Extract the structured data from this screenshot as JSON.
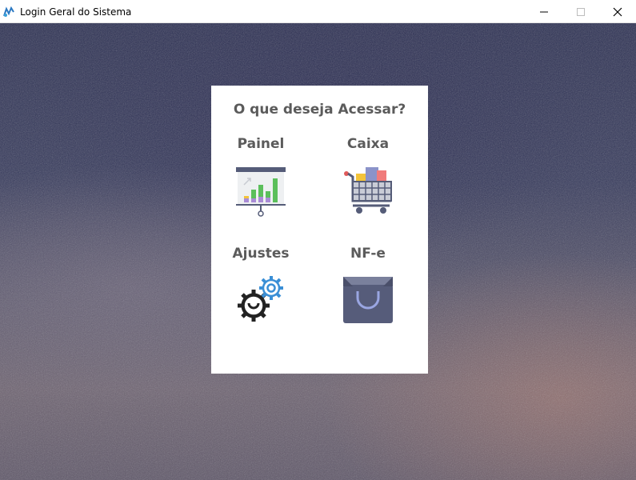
{
  "window": {
    "title": "Login Geral do Sistema"
  },
  "card": {
    "title": "O que deseja Acessar?",
    "tiles": [
      {
        "label": "Painel",
        "icon": "presentation-chart-icon"
      },
      {
        "label": "Caixa",
        "icon": "shopping-cart-icon"
      },
      {
        "label": "Ajustes",
        "icon": "gears-icon"
      },
      {
        "label": "NF-e",
        "icon": "shopping-bag-icon"
      }
    ]
  },
  "colors": {
    "label": "#5b5b5b",
    "card_bg": "#ffffff",
    "chart_green": "#5bbf5b",
    "chart_purple": "#a98bd6",
    "chart_yellow": "#f4c43a",
    "gear_blue": "#3a8fd6",
    "bag": "#565c7a"
  }
}
